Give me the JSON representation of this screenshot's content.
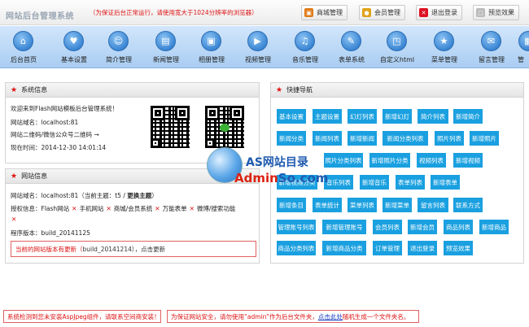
{
  "header": {
    "logo": "网站后台管理系统",
    "notice": "（为保证后台正常运行，请使用宽大于1024分辨率的浏览器）",
    "buttons": [
      {
        "label": "商城管理",
        "icon": "cart-icon"
      },
      {
        "label": "会员管理",
        "icon": "member-icon"
      },
      {
        "label": "退出登录",
        "icon": "close-icon"
      },
      {
        "label": "预览效果",
        "icon": "preview-icon"
      }
    ]
  },
  "nav": [
    {
      "label": "后台首页",
      "icon": "home-icon"
    },
    {
      "label": "基本设置",
      "icon": "heart-icon"
    },
    {
      "label": "简介管理",
      "icon": "person-icon"
    },
    {
      "label": "新闻管理",
      "icon": "news-icon"
    },
    {
      "label": "相册管理",
      "icon": "photo-icon"
    },
    {
      "label": "视频管理",
      "icon": "video-icon"
    },
    {
      "label": "音乐管理",
      "icon": "music-icon"
    },
    {
      "label": "表单系统",
      "icon": "form-icon"
    },
    {
      "label": "自定义html",
      "icon": "html-icon"
    },
    {
      "label": "菜单管理",
      "icon": "star-icon"
    },
    {
      "label": "留言管理",
      "icon": "message-icon"
    },
    {
      "label": "管",
      "icon": "more-icon"
    }
  ],
  "system_info": {
    "title": "系统信息",
    "welcome": "欢迎来到Flash网站模板后台管理系统！",
    "domain": "网站域名：localhost:81",
    "qrcode": "网站二维码/微信公众号二维码 →",
    "time": "现在时间：2014-12-30 14:01:14"
  },
  "site_info": {
    "title": "网站信息",
    "domain_prefix": "网站域名：localhost:81（当前主题：t5 / ",
    "change_theme": "更换主题",
    "domain_suffix": "）",
    "auth_prefix": "授权信息：Flash网站",
    "auth_items": [
      "手机网站",
      "商城/会员系统",
      "万能表单",
      "微博/搜索功能"
    ],
    "version": "程序版本：build_20141125",
    "update_prefix": "当前的网站版本有更新（",
    "update_version": "build_20141214",
    "update_suffix": "），点击更新"
  },
  "quick_nav": {
    "title": "快捷导航",
    "rows": [
      [
        "基本设置",
        "主题设置",
        "幻灯列表",
        "新增幻灯",
        "简介列表",
        "新增简介"
      ],
      [
        "新闻分类",
        "新闻列表",
        "新增新闻",
        "新闻分类列表",
        "照片列表",
        "新增照片"
      ],
      [
        "照片分类列表",
        "新增照片分类",
        "视频列表",
        "新增视频"
      ],
      [
        "新增视频分类",
        "音乐列表",
        "新增音乐",
        "表单列表",
        "新增表单"
      ],
      [
        "新增条目",
        "表单统计",
        "菜单列表",
        "新增菜单",
        "留言列表",
        "联系方式"
      ],
      [
        "管理账号列表",
        "新增管理账号",
        "会员列表",
        "新增会员",
        "商品列表",
        "新增商品"
      ],
      [
        "商品分类列表",
        "新增商品分类",
        "订单管理",
        "退出登录",
        "预览效果"
      ]
    ]
  },
  "watermark": {
    "line1": "AS网站目录",
    "line2_a": "Admin",
    "line2_b": "So.com"
  },
  "bottom": {
    "note1": "系统检测到您未安装AspJpeg组件，请联系空间商安装！",
    "note2_prefix": "为保证网站安全，请勿使用“admin”作为后台文件夹，",
    "note2_link": "点击此处",
    "note2_suffix": "随机生成一个文件夹名。"
  },
  "colors": {
    "accent": "#1aa0e0",
    "alert": "#dd1111",
    "nav_bg": "#a9cdf2"
  }
}
